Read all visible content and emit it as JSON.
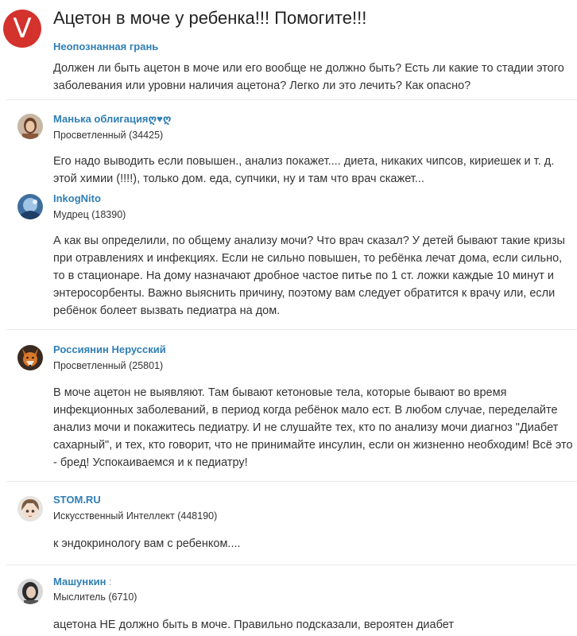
{
  "question": {
    "avatar_letter": "V",
    "title": "Ацетон в моче у ребенка!!! Помогите!!!",
    "author": "Неопознанная грань",
    "text": "Должен ли быть ацетон в моче или его вообще не должно быть? Есть ли какие то стадии этого заболевания или уровни наличия ацетона? Легко ли это лечить? Как опасно?"
  },
  "answers": [
    {
      "author": "Манька облигация",
      "author_suffix": "ღ♥ღ",
      "rank": "Просветленный (34425)",
      "text": "Его надо выводить если повышен., анализ покажет.... диета, никаких чипсов, кириешек и т. д. этой химии (!!!!), только дом. еда, супчики, ну и там что врач скажет..."
    },
    {
      "author": "InkogNito",
      "rank": "Мудрец (18390)",
      "text": "А как вы определили, по общему анализу мочи? Что врач сказал? У детей бывают такие кризы при отравлениях и инфекциях. Если не сильно повышен, то ребёнка лечат дома, если сильно, то в стационаре. На дому назначают дробное частое питье по 1 ст. ложки каждые 10 минут и энтеросорбенты. Важно выяснить причину, поэтому вам следует обратится к врачу или, если ребёнок болеет вызвать педиатра на дом."
    },
    {
      "author": "Россиянин Нерусский",
      "rank": "Просветленный (25801)",
      "text": "В моче ацетон не выявляют. Там бывают кетоновые тела, которые бывают во время инфекционных заболеваний, в период когда ребёнок мало ест. В любом случае, переделайте анализ мочи и покажитесь педиатру. И не слушайте тех, кто по анализу мочи диагноз \"Диабет сахарный\", и тех, кто говорит, что не принимайте инсулин, если он жизненно необходим! Всё это - бред! Успокаиваемся и к педиатру!"
    },
    {
      "author": "STOM.RU",
      "rank": "Искусственный Интеллект (448190)",
      "text": "к эндокринологу вам с ребенком...."
    },
    {
      "author": "Машункин",
      "author_suffix": ":",
      "rank": "Мыслитель (6710)",
      "text": "ацетона НЕ должно быть в моче. Правильно подсказали, вероятен диабет"
    }
  ],
  "colors": {
    "link": "#2f7fb5",
    "question_avatar": "#d4322c",
    "divider": "#e8e8e8",
    "text": "#333333"
  }
}
